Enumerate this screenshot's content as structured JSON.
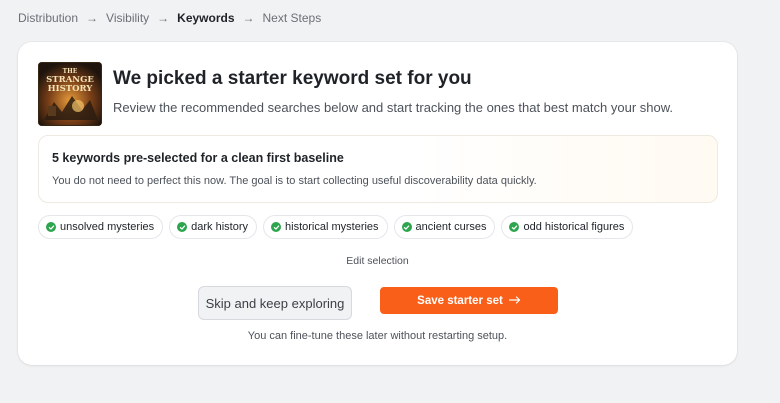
{
  "breadcrumb": {
    "items": [
      "Distribution",
      "Visibility",
      "Keywords",
      "Next Steps"
    ],
    "active_index": 2
  },
  "card": {
    "cover": {
      "title_line1": "THE",
      "title_line2": "STRANGE",
      "title_line3": "HISTORY"
    },
    "title": "We picked a starter keyword set for you",
    "subtitle": "Review the recommended searches below and start tracking the ones that best match your show.",
    "note": {
      "title": "5 keywords pre-selected for a clean first baseline",
      "text": "You do not need to perfect this now. The goal is to start collecting useful discoverability data quickly."
    },
    "keywords": [
      "unsolved mysteries",
      "dark history",
      "historical mysteries",
      "ancient curses",
      "odd historical figures"
    ],
    "edit_label": "Edit selection",
    "secondary_button": "Skip and keep exploring",
    "primary_button": "Save starter set",
    "footer_note": "You can fine-tune these later without restarting setup."
  },
  "colors": {
    "accent": "#fa5f1a",
    "check": "#2da44e",
    "background": "#f1f2f4"
  },
  "icons": {
    "separator": "arrow-right-icon",
    "chip_status": "check-circle-icon",
    "primary_button": "arrow-right-icon"
  }
}
